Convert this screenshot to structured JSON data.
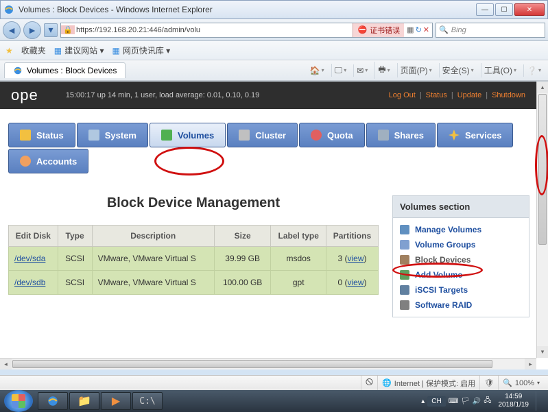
{
  "window": {
    "title": "Volumes : Block Devices - Windows Internet Explorer"
  },
  "address": {
    "url": "https://192.168.20.21:446/admin/volu",
    "cert_error": "证书错误",
    "search_engine": "Bing"
  },
  "favbar": {
    "label": "收藏夹",
    "link1": "建议网站 ▾",
    "link2": "网页快讯库 ▾"
  },
  "tab": {
    "title": "Volumes : Block Devices"
  },
  "ie_menu": {
    "page": "页面(P)",
    "safety": "安全(S)",
    "tools": "工具(O)"
  },
  "topbar": {
    "logo": "ope",
    "uptime": "15:00:17 up 14 min, 1 user, load average: 0.01, 0.10, 0.19",
    "links": [
      "Log Out",
      "Status",
      "Update",
      "Shutdown"
    ]
  },
  "tabs": [
    "Status",
    "System",
    "Volumes",
    "Cluster",
    "Quota",
    "Shares",
    "Services",
    "Accounts"
  ],
  "main_panel": {
    "title": "Block Device Management",
    "headers": [
      "Edit Disk",
      "Type",
      "Description",
      "Size",
      "Label type",
      "Partitions"
    ],
    "rows": [
      {
        "disk": "/dev/sda",
        "type": "SCSI",
        "desc": "VMware, VMware Virtual S",
        "size": "39.99 GB",
        "label": "msdos",
        "parts": "3",
        "view": "view"
      },
      {
        "disk": "/dev/sdb",
        "type": "SCSI",
        "desc": "VMware, VMware Virtual S",
        "size": "100.00 GB",
        "label": "gpt",
        "parts": "0",
        "view": "view"
      }
    ]
  },
  "side": {
    "title": "Volumes section",
    "items": [
      "Manage Volumes",
      "Volume Groups",
      "Block Devices",
      "Add Volume",
      "iSCSI Targets",
      "Software RAID"
    ]
  },
  "status": {
    "zone": "Internet | 保护模式: 启用",
    "zoom": "100%"
  },
  "tray": {
    "lang": "CH",
    "time": "14:59",
    "date": "2018/1/19"
  }
}
